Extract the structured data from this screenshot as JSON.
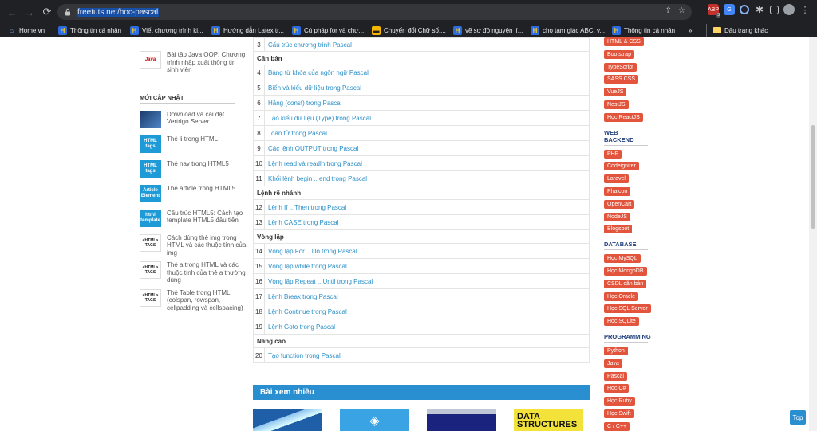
{
  "browser": {
    "url": "freetuts.net/hoc-pascal",
    "bookmarks": [
      {
        "label": "Home.vn",
        "fav": "home"
      },
      {
        "label": "Thông tin cá nhân",
        "fav": "h"
      },
      {
        "label": "Viết chương trình ki...",
        "fav": "h"
      },
      {
        "label": "Hướng dẫn Latex tr...",
        "fav": "h"
      },
      {
        "label": "Cú pháp for và chư...",
        "fav": "h"
      },
      {
        "label": "Chuyển đổi Chữ số,...",
        "fav": "yel"
      },
      {
        "label": "vẽ sơ đồ nguyên lí...",
        "fav": "h"
      },
      {
        "label": "cho tam giác ABC, v...",
        "fav": "h"
      },
      {
        "label": "Thông tin cá nhân",
        "fav": "h"
      }
    ],
    "bookmarks_more": "»",
    "other_bookmarks": "Dấu trang khác",
    "ext_badge": "3"
  },
  "left": {
    "top_item": "Bài tập Java OOP: Chương trình nhập xuất thông tin sinh viên",
    "top_thumb": "Java",
    "recent_heading": "MỚI CẬP NHẬT",
    "recent": [
      {
        "text": "Download và cài đặt Vertrigo Server",
        "thumb": "img",
        "t": ""
      },
      {
        "text": "Thẻ li trong HTML",
        "thumb": "html",
        "t": "HTML tags"
      },
      {
        "text": "Thẻ nav trong HTML5",
        "thumb": "html",
        "t": "HTML tags"
      },
      {
        "text": "Thẻ article trong HTML5",
        "thumb": "html",
        "t": "Article Element"
      },
      {
        "text": "Cấu trúc HTML5: Cách tạo template HTML5 đầu tiên",
        "thumb": "html",
        "t": "html template"
      },
      {
        "text": "Cách dùng thẻ img trong HTML và các thuộc tính của img",
        "thumb": "tag",
        "t": "<HTML> TAGS"
      },
      {
        "text": "Thẻ a trong HTML và các thuộc tính của thẻ a thường dùng",
        "thumb": "tag",
        "t": "<HTML> TAGS"
      },
      {
        "text": "Thẻ Table trong HTML (colspan, rowspan, cellpadding và cellspacing)",
        "thumb": "tag",
        "t": "<HTML> TAGS"
      }
    ]
  },
  "lessons": [
    {
      "num": "3",
      "title": "Cấu trúc chương trình Pascal"
    },
    {
      "section": "Căn bản"
    },
    {
      "num": "4",
      "title": "Bảng từ khóa của ngôn ngữ Pascal"
    },
    {
      "num": "5",
      "title": "Biến và kiểu dữ liệu trong Pascal"
    },
    {
      "num": "6",
      "title": "Hằng (const) trong Pascal"
    },
    {
      "num": "7",
      "title": "Tạo kiểu dữ liệu (Type) trong Pascal"
    },
    {
      "num": "8",
      "title": "Toán tử trong Pascal"
    },
    {
      "num": "9",
      "title": "Các lệnh OUTPUT trong Pascal"
    },
    {
      "num": "10",
      "title": "Lệnh read và readln trong Pascal"
    },
    {
      "num": "11",
      "title": "Khối lệnh begin .. end trong Pascal"
    },
    {
      "section": "Lệnh rẽ nhánh"
    },
    {
      "num": "12",
      "title": "Lệnh If .. Then trong Pascal"
    },
    {
      "num": "13",
      "title": "Lệnh CASE trong Pascal"
    },
    {
      "section": "Vòng lặp"
    },
    {
      "num": "14",
      "title": "Vòng lặp For .. Do trong Pascal"
    },
    {
      "num": "15",
      "title": "Vòng lặp while trong Pascal"
    },
    {
      "num": "16",
      "title": "Vòng lặp Repeat .. Until trong Pascal"
    },
    {
      "num": "17",
      "title": "Lệnh Break trong Pascal"
    },
    {
      "num": "18",
      "title": "Lệnh Continue trong Pascal"
    },
    {
      "num": "19",
      "title": "Lệnh Goto trong Pascal"
    },
    {
      "section": "Nâng cao"
    },
    {
      "num": "20",
      "title": "Tạo function trong Pascal"
    }
  ],
  "most_viewed": "Bài xem nhiều",
  "cards": [
    "",
    "",
    "",
    "DATA STRUCTURES"
  ],
  "right": {
    "top_tags": [
      "HTML & CSS",
      "Bootstrap",
      "TypeScript",
      "SASS CSS",
      "VueJS",
      "NestJS",
      "Học ReactJS"
    ],
    "categories": [
      {
        "heading": "WEB BACKEND",
        "tags": [
          "PHP",
          "Codeigniter",
          "Laravel",
          "Phalcon",
          "OpenCart",
          "NodeJS",
          "Blogspot"
        ]
      },
      {
        "heading": "DATABASE",
        "tags": [
          "Học MySQL",
          "Học MongoDB",
          "CSDL căn bản",
          "Học Oracle",
          "Học SQL Server",
          "Học SQLite"
        ]
      },
      {
        "heading": "PROGRAMMING",
        "tags": [
          "Python",
          "Java",
          "Pascal",
          "Học C#",
          "Học Ruby",
          "Học Swift",
          "C / C++"
        ]
      }
    ]
  },
  "top_button": "Top",
  "colors": {
    "accent": "#2a8fd0",
    "tag": "#e2543c",
    "link": "#2a8fc8"
  }
}
